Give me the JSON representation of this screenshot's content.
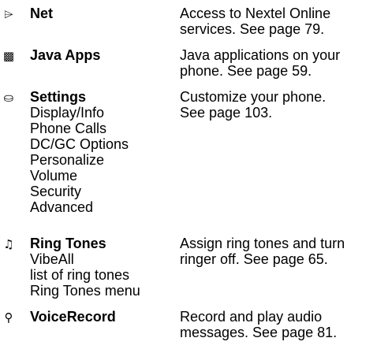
{
  "entries": [
    {
      "icon": "net-icon",
      "glyph": "⌲",
      "title": "Net",
      "items": [],
      "desc_lines": [
        "Access to Nextel Online",
        "services. See page 79."
      ]
    },
    {
      "icon": "java-apps-icon",
      "glyph": "▩",
      "title": "Java Apps",
      "items": [],
      "desc_lines": [
        "Java applications on your",
        "phone. See page 59."
      ]
    },
    {
      "icon": "settings-icon",
      "glyph": "⛀",
      "title": "Settings",
      "items": [
        "Display/Info",
        "Phone Calls",
        "DC/GC Options",
        "Personalize",
        "Volume",
        "Security",
        "Advanced"
      ],
      "desc_lines": [
        "Customize your phone.",
        "See page 103."
      ]
    },
    {
      "icon": "ring-tones-icon",
      "glyph": "♫",
      "title": "Ring Tones",
      "items": [
        "VibeAll",
        "list of ring tones",
        "Ring Tones menu"
      ],
      "desc_lines": [
        "Assign ring tones and turn",
        "ringer off. See page 65."
      ]
    },
    {
      "icon": "voice-record-icon",
      "glyph": "⚲",
      "title": "VoiceRecord",
      "items": [],
      "desc_lines": [
        "Record and play audio",
        "messages. See page 81."
      ]
    }
  ]
}
